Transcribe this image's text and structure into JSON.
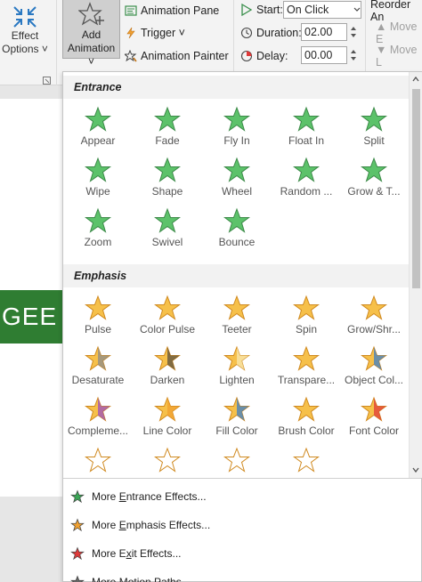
{
  "ribbon": {
    "effect_options": {
      "line1": "Effect",
      "line2": "Options ˅"
    },
    "add_animation": {
      "line1": "Add",
      "line2": "Animation ˅"
    },
    "animation_pane": "Animation Pane",
    "trigger": "Trigger ˅",
    "animation_painter": "Animation Painter",
    "start_label": "Start:",
    "start_value": "On Click",
    "duration_label": "Duration:",
    "duration_value": "02.00",
    "delay_label": "Delay:",
    "delay_value": "00.00",
    "reorder_label": "Reorder An",
    "move_earlier": "▲ Move E",
    "move_later": "▼ Move L"
  },
  "slide": {
    "text": "GEE",
    "color": "#2f7d32"
  },
  "gallery": {
    "entrance": {
      "title": "Entrance",
      "items": [
        "Appear",
        "Fade",
        "Fly In",
        "Float In",
        "Split",
        "Wipe",
        "Shape",
        "Wheel",
        "Random ...",
        "Grow & T...",
        "Zoom",
        "Swivel",
        "Bounce"
      ]
    },
    "emphasis": {
      "title": "Emphasis",
      "items": [
        "Pulse",
        "Color Pulse",
        "Teeter",
        "Spin",
        "Grow/Shr...",
        "Desaturate",
        "Darken",
        "Lighten",
        "Transpare...",
        "Object Col...",
        "Compleme...",
        "Line Color",
        "Fill Color",
        "Brush Color",
        "Font Color"
      ]
    }
  },
  "more_options": [
    {
      "prefix": "More ",
      "key": "E",
      "rest": "ntrance Effects...",
      "icon": "green-star-icon",
      "color": "#3aa655"
    },
    {
      "prefix": "More ",
      "key": "E",
      "rest": "mphasis Effects...",
      "icon": "orange-star-icon",
      "color": "#f0a030"
    },
    {
      "prefix": "More E",
      "key": "x",
      "rest": "it Effects...",
      "icon": "red-star-icon",
      "color": "#e03a3a"
    },
    {
      "prefix": "More ",
      "key": "M",
      "rest": "otion Paths...",
      "icon": "motion-path-star-icon",
      "color": "#666666"
    }
  ],
  "colors": {
    "entrance": "#5cc26a",
    "emphasis": "#f6c04a",
    "exit": "#e03a3a",
    "accent": "#2f7d32"
  }
}
